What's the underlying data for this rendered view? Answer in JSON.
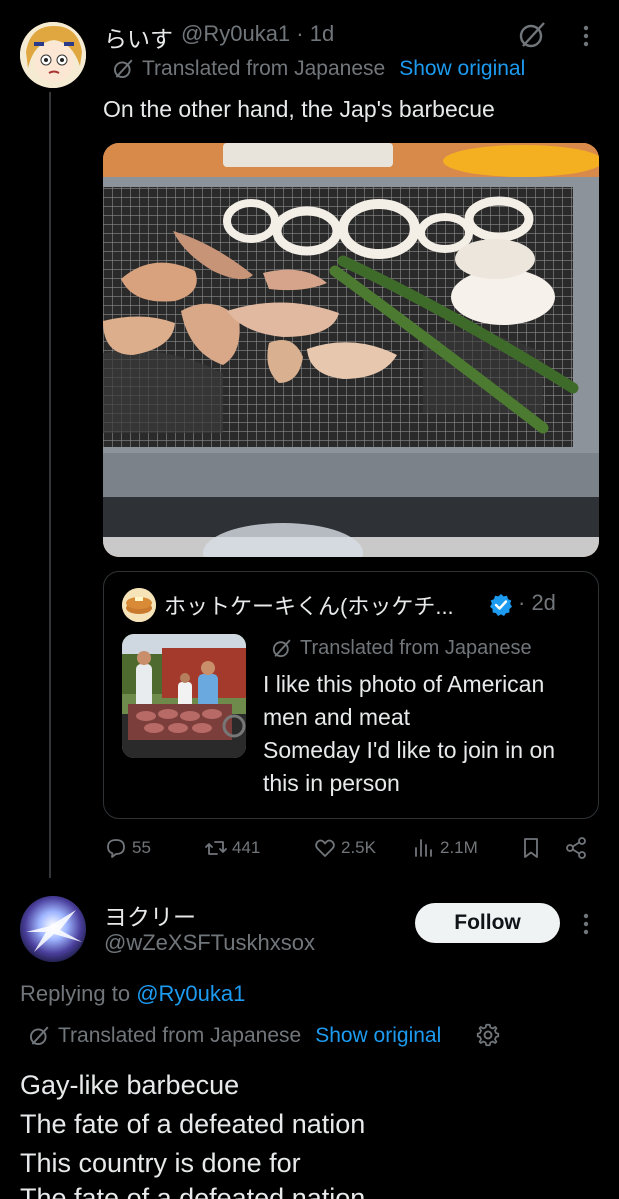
{
  "tweet1": {
    "display_name": "らいす",
    "handle_time": "@Ry0uka1 · 1d",
    "translated_label": "Translated from Japanese",
    "show_original": "Show original",
    "text": "On the other hand, the Jap's barbecue",
    "photo_icon": "grill-photo",
    "avatar_icon": "anime-avatar"
  },
  "quote": {
    "display_name": "ホットケーキくん(ホッケチ...",
    "date": "· 2d",
    "translated_label": "Translated from Japanese",
    "text_lines": [
      "I like this photo of American",
      "men and meat",
      "Someday I'd like to join in on",
      "this in person"
    ],
    "avatar_icon": "pancake-avatar",
    "thumb_icon": "bbq-men-photo"
  },
  "actions": {
    "replies": "55",
    "reposts": "441",
    "likes": "2.5K",
    "views": "2.1M"
  },
  "tweet2": {
    "display_name": "ヨクリー",
    "handle": "@wZeXSFTuskhxsox",
    "follow_label": "Follow",
    "replying_prefix": "Replying to ",
    "replying_handle": "@Ry0uka1",
    "translated_label": "Translated from Japanese",
    "show_original": "Show original",
    "text_lines": [
      "Gay-like barbecue",
      "The fate of a defeated nation",
      "This country is done for"
    ],
    "cutoff_line": "The fate of a defeated nation"
  },
  "colors": {
    "background": "#000000",
    "text": "#e7e9ea",
    "muted": "#71767b",
    "link": "#1d9bf0",
    "verified": "#1d9bf0"
  }
}
